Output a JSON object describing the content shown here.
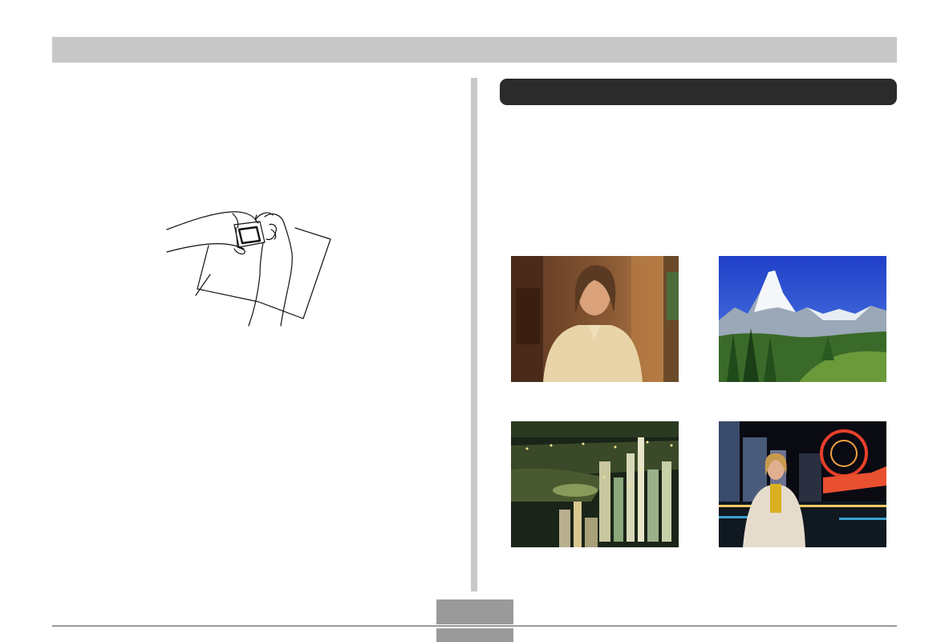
{
  "header": {
    "title": ""
  },
  "section": {
    "heading": ""
  },
  "illustration": {
    "name": "camera-held-against-paper"
  },
  "photos": [
    {
      "subject": "portrait"
    },
    {
      "subject": "mountain-scenery"
    },
    {
      "subject": "night-city-scene"
    },
    {
      "subject": "night-scene-portrait"
    }
  ],
  "footer": {
    "page_number": ""
  },
  "colors": {
    "header_bar": "#c8c8c8",
    "section_bar": "#2b2b2b",
    "divider": "#c8c8c8",
    "footer": "#9a9a9a"
  }
}
